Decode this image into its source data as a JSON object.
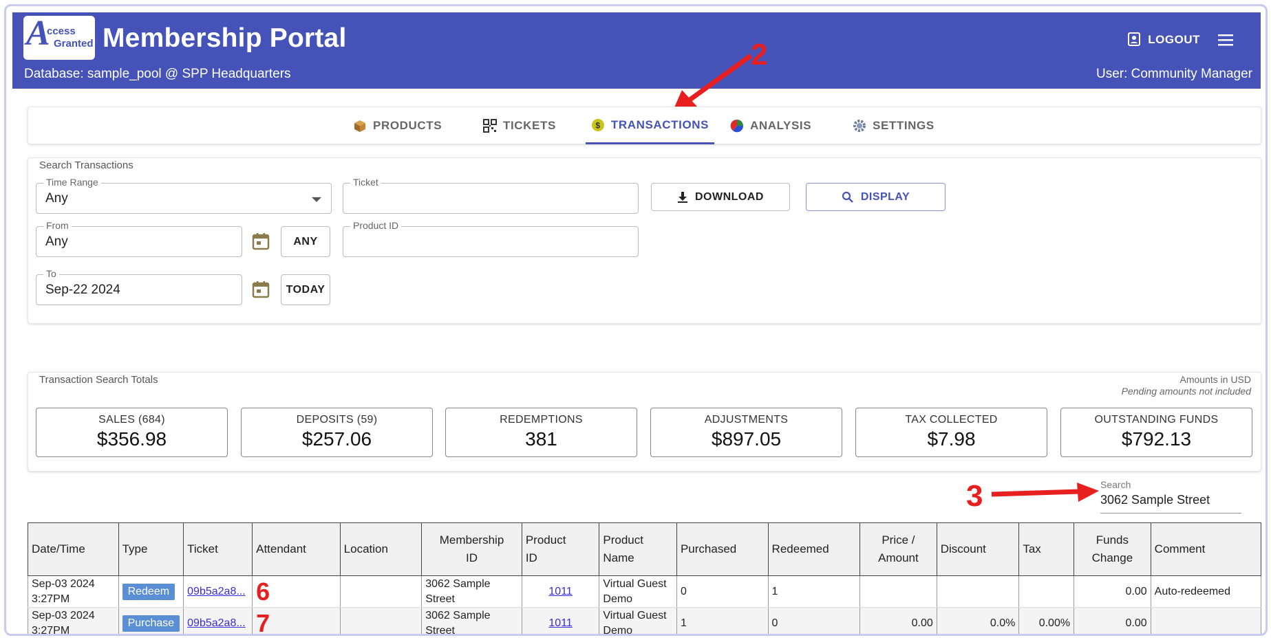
{
  "header": {
    "logo_letter": "A",
    "logo_line1": "ccess",
    "logo_line2": "Granted",
    "title": "Membership Portal",
    "database": "Database: sample_pool @ SPP Headquarters",
    "user": "User: Community Manager",
    "logout_label": "LOGOUT"
  },
  "annotations": {
    "tabs": "2",
    "search": "3",
    "row1": "6",
    "row2": "7"
  },
  "tabs": [
    {
      "label": "PRODUCTS",
      "icon": "box-icon"
    },
    {
      "label": "TICKETS",
      "icon": "qr-code-icon"
    },
    {
      "label": "TRANSACTIONS",
      "icon": "coin-icon",
      "active": true
    },
    {
      "label": "ANALYSIS",
      "icon": "pie-chart-icon"
    },
    {
      "label": "SETTINGS",
      "icon": "gear-icon"
    }
  ],
  "search": {
    "caption": "Search Transactions",
    "time_range_label": "Time Range",
    "time_range_value": "Any",
    "ticket_label": "Ticket",
    "ticket_value": "",
    "product_id_label": "Product ID",
    "product_id_value": "",
    "from_label": "From",
    "from_value": "Any",
    "any_button": "ANY",
    "to_label": "To",
    "to_value": "Sep-22 2024",
    "today_button": "TODAY",
    "download_button": "DOWNLOAD",
    "display_button": "DISPLAY"
  },
  "totals": {
    "caption": "Transaction Search Totals",
    "currency_note": "Amounts in USD",
    "pending_note": "Pending amounts not included",
    "items": [
      {
        "label": "SALES (684)",
        "value": "$356.98"
      },
      {
        "label": "DEPOSITS (59)",
        "value": "$257.06"
      },
      {
        "label": "REDEMPTIONS",
        "value": "381"
      },
      {
        "label": "ADJUSTMENTS",
        "value": "$897.05"
      },
      {
        "label": "TAX COLLECTED",
        "value": "$7.98"
      },
      {
        "label": "OUTSTANDING FUNDS",
        "value": "$792.13"
      }
    ]
  },
  "table_search": {
    "label": "Search",
    "value": "3062 Sample Street"
  },
  "table": {
    "headers": {
      "datetime": "Date/Time",
      "type": "Type",
      "ticket": "Ticket",
      "attendant": "Attendant",
      "location": "Location",
      "membership_id_1": "Membership",
      "membership_id_2": "ID",
      "product_id_1": "Product",
      "product_id_2": "ID",
      "product_name_1": "Product",
      "product_name_2": "Name",
      "purchased": "Purchased",
      "redeemed": "Redeemed",
      "price_1": "Price /",
      "price_2": "Amount",
      "discount": "Discount",
      "tax": "Tax",
      "funds_1": "Funds",
      "funds_2": "Change",
      "comment": "Comment"
    },
    "rows": [
      {
        "date": "Sep-03 2024",
        "time": "3:27PM",
        "type": "Redeem",
        "ticket": "09b5a2a8...",
        "attendant": "",
        "location": "",
        "membership_1": "3062 Sample",
        "membership_2": "Street",
        "product_id": "1011",
        "product_name_1": "Virtual Guest",
        "product_name_2": "Demo",
        "purchased": "0",
        "redeemed": "1",
        "price": "",
        "discount": "",
        "tax": "",
        "funds_change": "0.00",
        "comment": "Auto-redeemed"
      },
      {
        "date": "Sep-03 2024",
        "time": "3:27PM",
        "type": "Purchase",
        "ticket": "09b5a2a8...",
        "attendant": "",
        "location": "",
        "membership_1": "3062 Sample",
        "membership_2": "Street",
        "product_id": "1011",
        "product_name_1": "Virtual Guest",
        "product_name_2": "Demo",
        "purchased": "1",
        "redeemed": "0",
        "price": "0.00",
        "discount": "0.0%",
        "tax": "0.00%",
        "funds_change": "0.00",
        "comment": ""
      }
    ]
  },
  "colors": {
    "primary": "#4552b8",
    "annotation": "#e81f1f",
    "badge": "#5a8fd6"
  }
}
